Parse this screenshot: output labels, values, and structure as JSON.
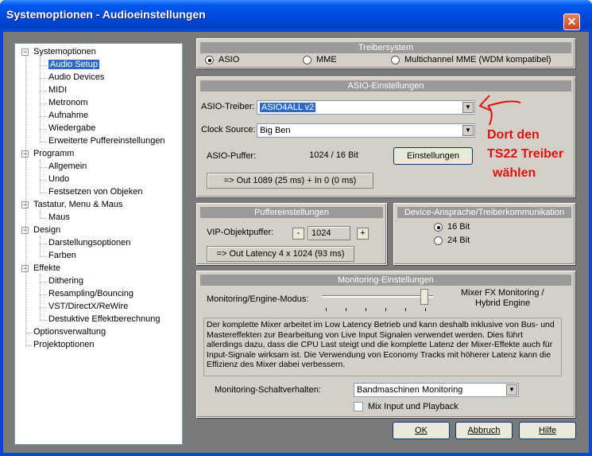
{
  "window": {
    "title": "Systemoptionen - Audioeinstellungen",
    "close_glyph": "✕"
  },
  "tree": [
    {
      "label": "Systemoptionen",
      "expander": "−"
    },
    {
      "label": "Audio Setup",
      "selected": true
    },
    {
      "label": "Audio Devices"
    },
    {
      "label": "MIDI"
    },
    {
      "label": "Metronom"
    },
    {
      "label": "Aufnahme"
    },
    {
      "label": "Wiedergabe"
    },
    {
      "label": "Erweiterte Puffereinstellungen"
    },
    {
      "label": "Programm",
      "expander": "−"
    },
    {
      "label": "Allgemein"
    },
    {
      "label": "Undo"
    },
    {
      "label": "Festsetzen von Objeken"
    },
    {
      "label": "Tastatur, Menu & Maus",
      "expander": "−"
    },
    {
      "label": "Maus"
    },
    {
      "label": "Design",
      "expander": "−"
    },
    {
      "label": "Darstellungsoptionen"
    },
    {
      "label": "Farben"
    },
    {
      "label": "Effekte",
      "expander": "−"
    },
    {
      "label": "Dithering"
    },
    {
      "label": "Resampling/Bouncing"
    },
    {
      "label": "VST/DirectX/ReWire"
    },
    {
      "label": "Destuktive Effektberechnung"
    },
    {
      "label": "Optionsverwaltung"
    },
    {
      "label": "Projektoptionen"
    }
  ],
  "treiber": {
    "header": "Treibersystem",
    "options": [
      "ASIO",
      "MME",
      "Multichannel MME (WDM kompatibel)"
    ],
    "selected": "ASIO"
  },
  "asio": {
    "header": "ASIO-Einstellungen",
    "treiber_label": "ASIO-Treiber:",
    "treiber_value": "ASIO4ALL v2",
    "clock_label": "Clock Source:",
    "clock_value": "Big Ben",
    "puffer_label": "ASIO-Puffer:",
    "puffer_value": "1024 / 16 Bit",
    "einstellungen_button": "Einstellungen",
    "latency_text": "=> Out 1089 (25 ms) + In 0 (0 ms)"
  },
  "puffer": {
    "header": "Puffereinstellungen",
    "vip_label": "VIP-Objektpuffer:",
    "minus": "-",
    "value": "1024",
    "plus": "+",
    "latency_text": "=> Out Latency 4 x 1024 (93 ms)"
  },
  "device": {
    "header": "Device-Ansprache/Treiberkommunikation",
    "options": [
      "16 Bit",
      "24 Bit"
    ],
    "selected": "16 Bit"
  },
  "monitoring": {
    "header": "Monitoring-Einstellungen",
    "mode_label": "Monitoring/Engine-Modus:",
    "mode_value_line1": "Mixer FX Monitoring /",
    "mode_value_line2": "Hybrid Engine",
    "slider_level": 1.0,
    "description": "Der komplette Mixer arbeitet im Low Latency Betrieb und kann deshalb inklusive von Bus- und Mastereffekten zur Bearbeitung von Live Input Signalen verwendet werden. Dies führt allerdings dazu, dass die CPU Last steigt und die komplette Latenz der Mixer-Effekte auch für Input-Signale wirksam ist. Die Verwendung von Economy Tracks mit höherer Latenz kann die Effizienz des Mixer dabei verbessern.",
    "schalt_label": "Monitoring-Schaltverhalten:",
    "schalt_value": "Bandmaschinen Monitoring",
    "mix_input_label": "Mix Input und Playback",
    "mix_input_checked": false
  },
  "buttons": {
    "ok": "OK",
    "abbruch": "Abbruch",
    "hilfe": "Hilfe"
  },
  "annotation": {
    "line1": "Dort den",
    "line2": "TS22 Treiber",
    "line3": "wählen",
    "color": "#E01010"
  }
}
